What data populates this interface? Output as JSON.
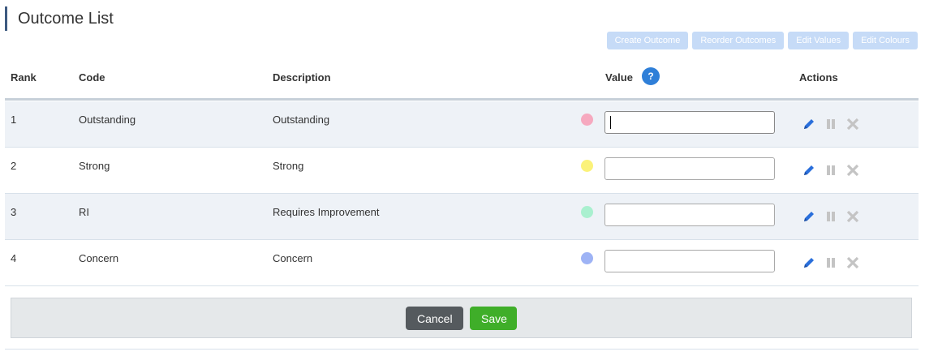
{
  "page": {
    "title": "Outcome List"
  },
  "toolbar": {
    "buttons": [
      {
        "label": "Create Outcome"
      },
      {
        "label": "Reorder Outcomes"
      },
      {
        "label": "Edit Values"
      },
      {
        "label": "Edit Colours"
      }
    ]
  },
  "table": {
    "headers": {
      "rank": "Rank",
      "code": "Code",
      "description": "Description",
      "value": "Value",
      "actions": "Actions"
    },
    "help_glyph": "?",
    "rows": [
      {
        "rank": "1",
        "code": "Outstanding",
        "description": "Outstanding",
        "color": "#f6a9bf",
        "value": ""
      },
      {
        "rank": "2",
        "code": "Strong",
        "description": "Strong",
        "color": "#fbf27a",
        "value": ""
      },
      {
        "rank": "3",
        "code": "RI",
        "description": "Requires Improvement",
        "color": "#a9f0cf",
        "value": ""
      },
      {
        "rank": "4",
        "code": "Concern",
        "description": "Concern",
        "color": "#9eb3f5",
        "value": ""
      }
    ]
  },
  "footer": {
    "cancel_label": "Cancel",
    "save_label": "Save"
  },
  "icons": {
    "edit": "pencil-icon",
    "suspend": "pause-icon",
    "delete": "close-icon"
  }
}
